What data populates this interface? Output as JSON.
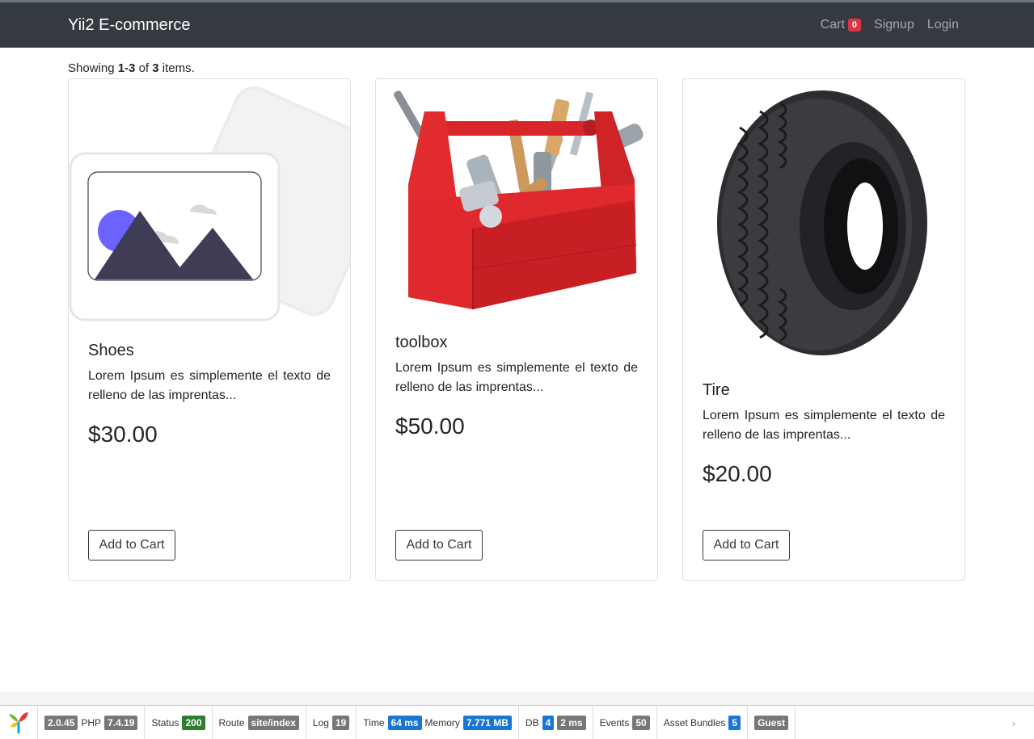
{
  "navbar": {
    "brand": "Yii2 E-commerce",
    "cart_label": "Cart",
    "cart_count": "0",
    "signup_label": "Signup",
    "login_label": "Login"
  },
  "summary": {
    "prefix": "Showing ",
    "range": "1-3",
    "middle": " of ",
    "total": "3",
    "suffix": " items."
  },
  "products": [
    {
      "name": "Shoes",
      "description": "Lorem Ipsum es simplemente el texto de relleno de las imprentas...",
      "price": "$30.00",
      "button": "Add to Cart",
      "image_icon": "image-placeholder-icon"
    },
    {
      "name": "toolbox",
      "description": "Lorem Ipsum es simplemente el texto de relleno de las imprentas...",
      "price": "$50.00",
      "button": "Add to Cart",
      "image_icon": "toolbox-image"
    },
    {
      "name": "Tire",
      "description": "Lorem Ipsum es simplemente el texto de relleno de las imprentas...",
      "price": "$20.00",
      "button": "Add to Cart",
      "image_icon": "tire-image"
    }
  ],
  "debug": {
    "version": "2.0.45",
    "php_label": "PHP",
    "php_version": "7.4.19",
    "status_label": "Status",
    "status_code": "200",
    "route_label": "Route",
    "route": "site/index",
    "log_label": "Log",
    "log_count": "19",
    "time_label": "Time",
    "time": "64 ms",
    "memory_label": "Memory",
    "memory": "7.771 MB",
    "db_label": "DB",
    "db_count": "4",
    "db_time": "2 ms",
    "events_label": "Events",
    "events_count": "50",
    "assets_label": "Asset Bundles",
    "assets_count": "5",
    "user": "Guest",
    "toggle_icon": "chevron-right-icon"
  },
  "colors": {
    "navbar_bg": "#343a40",
    "cart_badge": "#dc3545",
    "status_green": "#2e7d32",
    "debug_blue": "#1976d2"
  }
}
